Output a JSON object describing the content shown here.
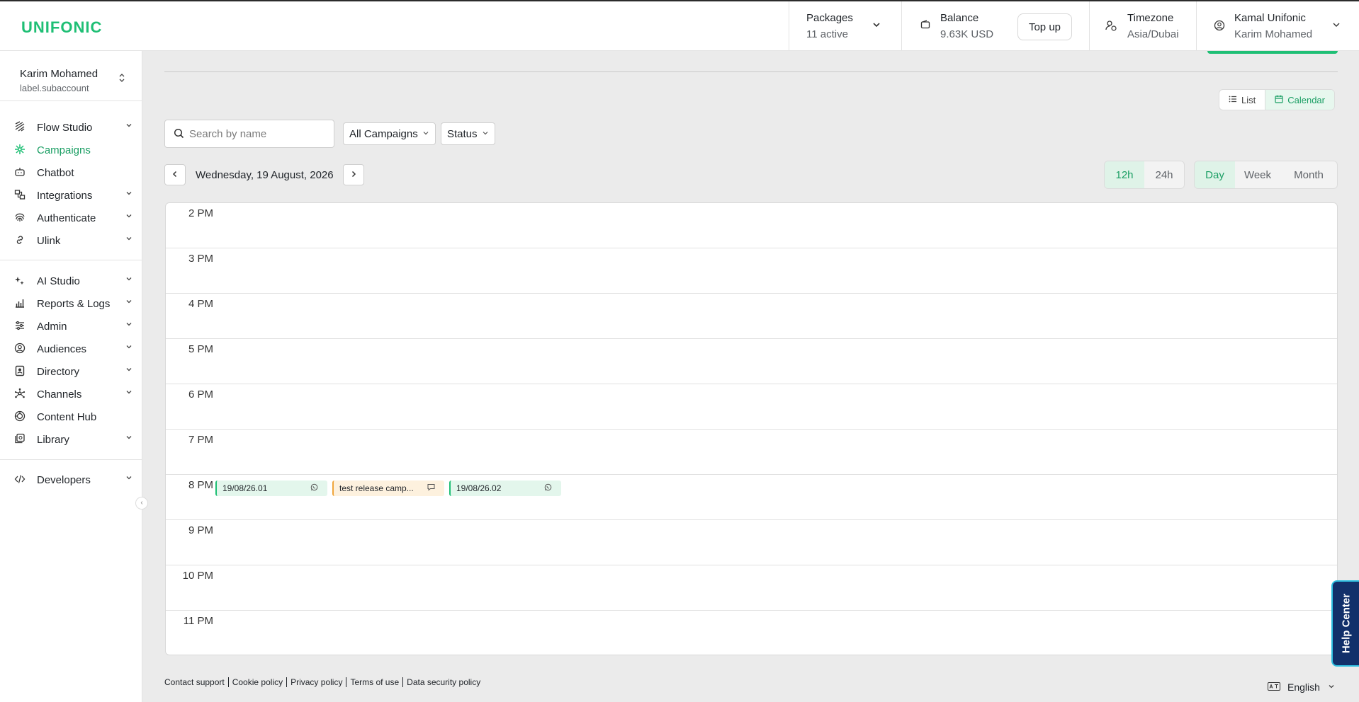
{
  "brand": {
    "logo_text": "UNIFONIC",
    "accent": "#1fbf75"
  },
  "header": {
    "packages": {
      "label": "Packages",
      "value": "11 active"
    },
    "balance": {
      "label": "Balance",
      "value": "9.63K USD",
      "topup_label": "Top up"
    },
    "timezone": {
      "label": "Timezone",
      "value": "Asia/Dubai"
    },
    "user": {
      "name": "Kamal Unifonic",
      "subname": "Karim Mohamed"
    }
  },
  "account": {
    "name": "Karim Mohamed",
    "sub": "label.subaccount"
  },
  "sidebar": {
    "items": [
      {
        "label": "Flow Studio",
        "icon": "flow-studio-icon",
        "expandable": true
      },
      {
        "label": "Campaigns",
        "icon": "campaigns-icon",
        "expandable": false,
        "active": true
      },
      {
        "label": "Chatbot",
        "icon": "chatbot-icon",
        "expandable": false
      },
      {
        "label": "Integrations",
        "icon": "integrations-icon",
        "expandable": true
      },
      {
        "label": "Authenticate",
        "icon": "fingerprint-icon",
        "expandable": true
      },
      {
        "label": "Ulink",
        "icon": "link-icon",
        "expandable": true
      },
      {
        "label": "AI Studio",
        "icon": "sparkle-icon",
        "expandable": true
      },
      {
        "label": "Reports & Logs",
        "icon": "chart-icon",
        "expandable": true
      },
      {
        "label": "Admin",
        "icon": "sliders-icon",
        "expandable": true
      },
      {
        "label": "Audiences",
        "icon": "user-circle-icon",
        "expandable": true
      },
      {
        "label": "Directory",
        "icon": "contact-book-icon",
        "expandable": true
      },
      {
        "label": "Channels",
        "icon": "network-icon",
        "expandable": true
      },
      {
        "label": "Content Hub",
        "icon": "content-icon",
        "expandable": false
      },
      {
        "label": "Library",
        "icon": "library-icon",
        "expandable": true
      },
      {
        "label": "Developers",
        "icon": "code-icon",
        "expandable": true
      }
    ]
  },
  "toolbar": {
    "view_list_label": "List",
    "view_calendar_label": "Calendar",
    "search_placeholder": "Search by name",
    "campaign_filter": "All Campaigns",
    "status_filter": "Status"
  },
  "calendar": {
    "date_label": "Wednesday, 19 August, 2026",
    "time_format": {
      "options": [
        "12h",
        "24h"
      ],
      "selected": "12h"
    },
    "range": {
      "options": [
        "Day",
        "Week",
        "Month"
      ],
      "selected": "Day"
    },
    "hours": [
      "2 PM",
      "3 PM",
      "4 PM",
      "5 PM",
      "6 PM",
      "7 PM",
      "8 PM",
      "9 PM",
      "10 PM",
      "11 PM"
    ],
    "events": [
      {
        "title": "19/08/26.01",
        "hour": "8 PM",
        "channel_icon": "whatsapp-icon",
        "color": "#1fbf75"
      },
      {
        "title": "test release camp...",
        "hour": "8 PM",
        "channel_icon": "message-icon",
        "color": "#f0a53b"
      },
      {
        "title": "19/08/26.02",
        "hour": "8 PM",
        "channel_icon": "whatsapp-icon",
        "color": "#1fbf75"
      }
    ]
  },
  "footer": {
    "links": [
      "Contact support",
      "Cookie policy",
      "Privacy policy",
      "Terms of use",
      "Data security policy"
    ],
    "language": "English"
  },
  "help_center": {
    "label": "Help Center"
  }
}
